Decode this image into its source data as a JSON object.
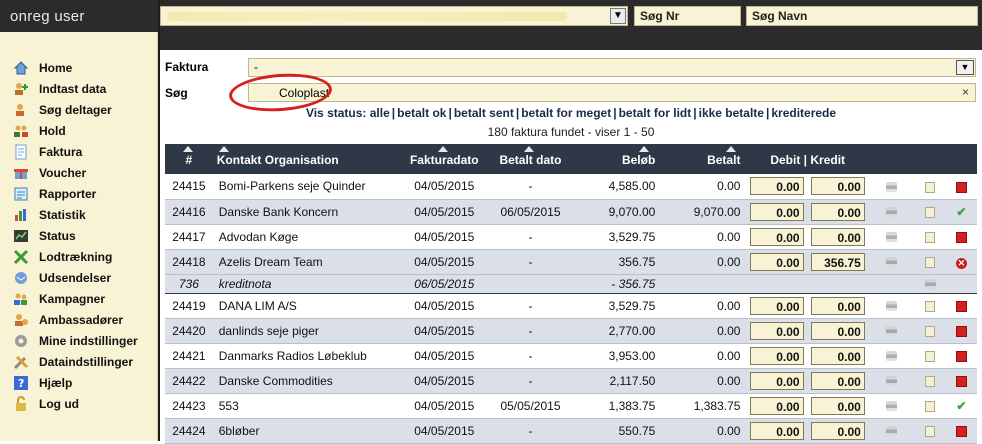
{
  "app": {
    "title": "onreg user",
    "top": {
      "nr_placeholder": "Søg Nr",
      "navn_placeholder": "Søg Navn"
    }
  },
  "sidebar": {
    "items": [
      {
        "label": "Home",
        "icon": "home-icon"
      },
      {
        "label": "Indtast data",
        "icon": "add-user-icon"
      },
      {
        "label": "Søg deltager",
        "icon": "search-user-icon"
      },
      {
        "label": "Hold",
        "icon": "team-icon"
      },
      {
        "label": "Faktura",
        "icon": "invoice-icon"
      },
      {
        "label": "Voucher",
        "icon": "gift-icon"
      },
      {
        "label": "Rapporter",
        "icon": "reports-icon"
      },
      {
        "label": "Statistik",
        "icon": "bar-chart-icon"
      },
      {
        "label": "Status",
        "icon": "status-chart-icon"
      },
      {
        "label": "Lodtrækning",
        "icon": "lottery-icon"
      },
      {
        "label": "Udsendelser",
        "icon": "mail-icon"
      },
      {
        "label": "Kampagner",
        "icon": "campaign-icon"
      },
      {
        "label": "Ambassadører",
        "icon": "ambassador-icon"
      },
      {
        "label": "Mine indstillinger",
        "icon": "gear-icon"
      },
      {
        "label": "Dataindstillinger",
        "icon": "tools-icon"
      },
      {
        "label": "Hjælp",
        "icon": "help-icon"
      },
      {
        "label": "Log ud",
        "icon": "padlock-icon"
      }
    ]
  },
  "filters": {
    "faktura_label": "Faktura",
    "faktura_value": "-",
    "search_label": "Søg",
    "search_value": "Coloplast",
    "search_clear": "×"
  },
  "status": {
    "prefix": "Vis status:",
    "options": [
      "alle",
      "betalt ok",
      "betalt sent",
      "betalt for meget",
      "betalt for lidt",
      "ikke betalte",
      "krediterede"
    ],
    "count_text": "180 faktura fundet - viser 1 - 50"
  },
  "table": {
    "headers": {
      "num": "#",
      "org": "Kontakt Organisation",
      "date": "Fakturadato",
      "paid_date": "Betalt dato",
      "amount": "Beløb",
      "paid": "Betalt",
      "debit_credit": "Debit | Kredit"
    },
    "rows": [
      {
        "num": "24415",
        "org": "Bomi-Parkens seje Quinder",
        "date": "04/05/2015",
        "paid_date": "-",
        "amount": "4,585.00",
        "paid": "0.00",
        "debit": "0.00",
        "credit": "0.00",
        "status": "unpaid"
      },
      {
        "num": "24416",
        "org": "Danske Bank Koncern",
        "date": "04/05/2015",
        "paid_date": "06/05/2015",
        "amount": "9,070.00",
        "paid": "9,070.00",
        "debit": "0.00",
        "credit": "0.00",
        "status": "ok"
      },
      {
        "num": "24417",
        "org": "Advodan Køge",
        "date": "04/05/2015",
        "paid_date": "-",
        "amount": "3,529.75",
        "paid": "0.00",
        "debit": "0.00",
        "credit": "0.00",
        "status": "unpaid"
      },
      {
        "num": "24418",
        "org": "Azelis Dream Team",
        "date": "04/05/2015",
        "paid_date": "-",
        "amount": "356.75",
        "paid": "0.00",
        "debit": "0.00",
        "credit": "356.75",
        "status": "credited"
      },
      {
        "num": "736",
        "org": "kreditnota",
        "date": "06/05/2015",
        "paid_date": "",
        "amount": "- 356.75",
        "paid": "",
        "debit": "",
        "credit": "",
        "status": "creditnote"
      },
      {
        "num": "24419",
        "org": "DANA LIM A/S",
        "date": "04/05/2015",
        "paid_date": "-",
        "amount": "3,529.75",
        "paid": "0.00",
        "debit": "0.00",
        "credit": "0.00",
        "status": "unpaid"
      },
      {
        "num": "24420",
        "org": "danlinds seje piger",
        "date": "04/05/2015",
        "paid_date": "-",
        "amount": "2,770.00",
        "paid": "0.00",
        "debit": "0.00",
        "credit": "0.00",
        "status": "unpaid"
      },
      {
        "num": "24421",
        "org": "Danmarks Radios Løbeklub",
        "date": "04/05/2015",
        "paid_date": "-",
        "amount": "3,953.00",
        "paid": "0.00",
        "debit": "0.00",
        "credit": "0.00",
        "status": "unpaid"
      },
      {
        "num": "24422",
        "org": "Danske Commodities",
        "date": "04/05/2015",
        "paid_date": "-",
        "amount": "2,117.50",
        "paid": "0.00",
        "debit": "0.00",
        "credit": "0.00",
        "status": "unpaid"
      },
      {
        "num": "24423",
        "org": "553",
        "date": "04/05/2015",
        "paid_date": "05/05/2015",
        "amount": "1,383.75",
        "paid": "1,383.75",
        "debit": "0.00",
        "credit": "0.00",
        "status": "ok"
      },
      {
        "num": "24424",
        "org": "6bløber",
        "date": "04/05/2015",
        "paid_date": "-",
        "amount": "550.75",
        "paid": "0.00",
        "debit": "0.00",
        "credit": "0.00",
        "status": "unpaid"
      }
    ]
  },
  "colors": {
    "header_bg": "#2f3847",
    "sidebar_bg": "#f7f3d4",
    "row_alt": "#dadfe8",
    "accent_red": "#d62020"
  }
}
